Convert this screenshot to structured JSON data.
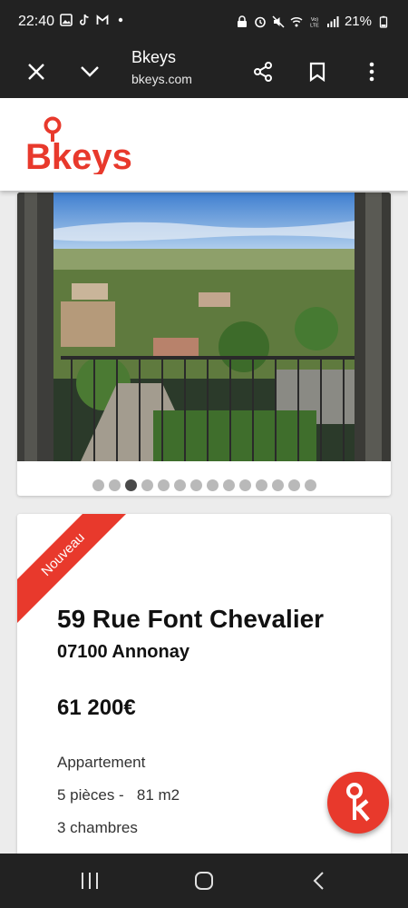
{
  "status_bar": {
    "time": "22:40",
    "battery": "21%",
    "left_icons": [
      "image-icon",
      "tiktok-icon",
      "gmail-icon",
      "dot-icon"
    ],
    "right_icons": [
      "vpn-icon",
      "alarm-icon",
      "mute-icon",
      "wifi-icon",
      "volte-icon",
      "signal-icon",
      "battery-icon"
    ]
  },
  "browser": {
    "title": "Bkeys",
    "url": "bkeys.com"
  },
  "site": {
    "logo_text": "Bkeys",
    "brand_color": "#e8392c"
  },
  "gallery": {
    "count": 14,
    "active_index": 2
  },
  "listing": {
    "badge": "Nouveau",
    "address": "59 Rue Font Chevalier",
    "city": "07100 Annonay",
    "price": "61 200€",
    "type": "Appartement",
    "rooms": "5 pièces -   81 m2",
    "bedrooms": "3 chambres"
  }
}
